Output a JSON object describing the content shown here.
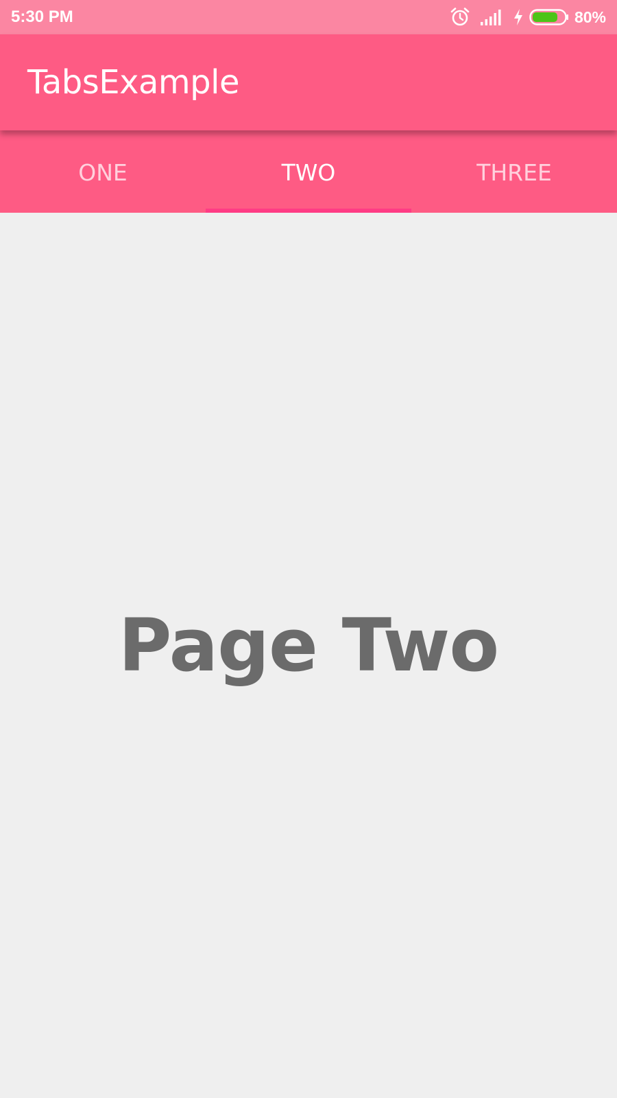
{
  "status_bar": {
    "time": "5:30 PM",
    "battery_percent": "80%",
    "battery_level": 0.8,
    "icons": [
      "alarm-icon",
      "signal-icon",
      "charging-icon",
      "battery-icon"
    ]
  },
  "app_bar": {
    "title": "TabsExample"
  },
  "tabs": {
    "items": [
      {
        "label": "ONE"
      },
      {
        "label": "TWO"
      },
      {
        "label": "THREE"
      }
    ],
    "selected_index": 1
  },
  "content": {
    "heading": "Page Two"
  },
  "colors": {
    "status_bar": "#fb86a2",
    "primary": "#fe5b84",
    "indicator": "#ff3c85",
    "background": "#efefef",
    "heading_text": "#6b6b6b",
    "battery_fill": "#4cc417"
  }
}
